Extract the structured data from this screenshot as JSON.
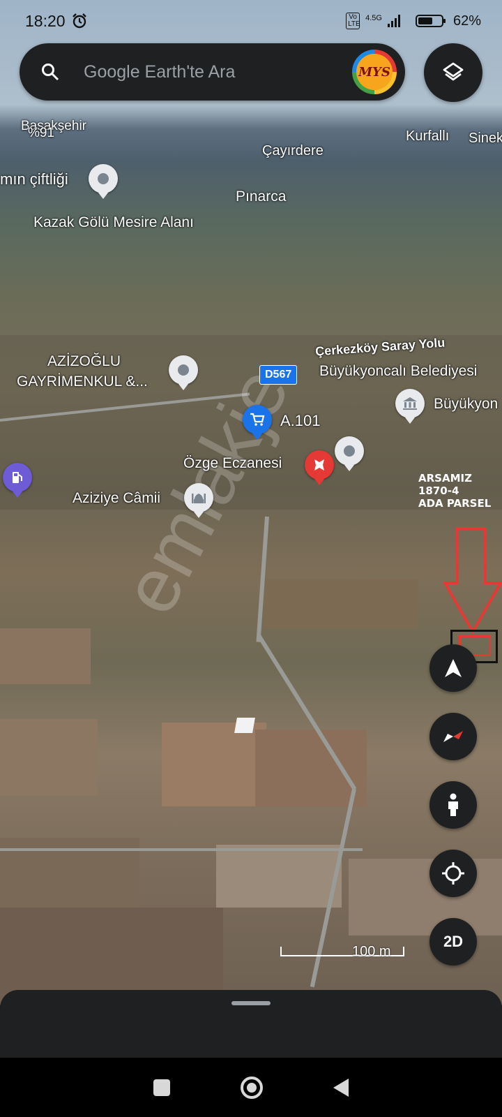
{
  "status_bar": {
    "time": "18:20",
    "alarm_icon": "alarm-clock-icon",
    "volte": "Vo LTE",
    "network": "4.5G",
    "battery_percent": "62%",
    "battery_level": 0.62
  },
  "search": {
    "placeholder": "Google Earth'te Ara",
    "logo_text": "MYS"
  },
  "map_labels": {
    "basaksehir": "Başakşehir",
    "percent": "%91",
    "kurfalli": "Kurfallı",
    "sinek": "Sinek",
    "cayirdere": "Çayırdere",
    "ciftligi": "mın çiftliği",
    "pinarca": "Pınarca",
    "kazak_golu": "Kazak Gölü Mesire Alanı",
    "azizoglu_1": "AZİZOĞLU",
    "azizoglu_2": "GAYRİMENKUL &...",
    "cerkezkoy_road": "Çerkezköy Saray Yolu",
    "road_shield": "D567",
    "belediyesi": "Büyükyoncalı Belediyesi",
    "buyukyon": "Büyükyon",
    "a101": "A.101",
    "eczane": "Özge Eczanesi",
    "camii": "Aziziye Câmii"
  },
  "parcel": {
    "line1": "ARSAMIZ",
    "line2": "1870-4",
    "line3": "ADA PARSEL",
    "highlight_color": "#e53935"
  },
  "watermark": "emlakje",
  "controls": {
    "compass_label": "compass",
    "mode_2d": "2D"
  },
  "scale_bar": "100 m",
  "colors": {
    "panel": "#1f2022",
    "accent_blue": "#1a73e8",
    "pin_red": "#e53935"
  }
}
